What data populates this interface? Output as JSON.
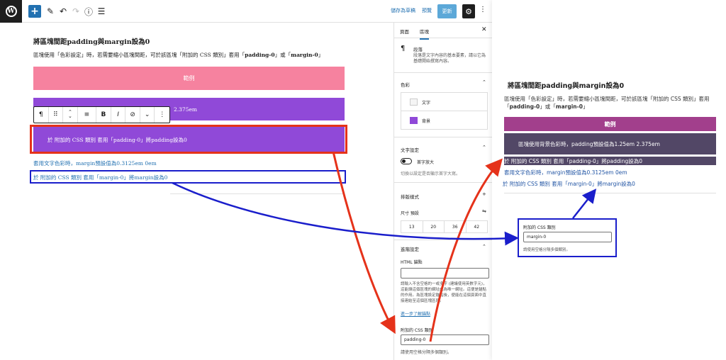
{
  "toolbar": {
    "logo_letter": "W",
    "add_icon": "plus-icon",
    "edit_icon": "pencil-icon",
    "undo_icon": "undo-icon",
    "redo_icon": "redo-icon",
    "info_icon": "info-icon",
    "list_view_icon": "list-view-icon",
    "save_draft_label": "儲存為草稿",
    "preview_label": "預覽",
    "update_label": "更新",
    "settings_icon": "gear-icon",
    "more_icon": "vertical-ellipsis-icon"
  },
  "editor": {
    "heading": "將區塊間距padding與margin設為0",
    "paragraph_parts": [
      "區塊使用「色彩設定」時，若需要縮小區塊間距，可於該區塊「附加的 CSS 類別」套用「",
      "padding-0",
      "」或「",
      "margin-0",
      "」"
    ],
    "pink_block_text": "範例",
    "purple_block1_text": "2.375em",
    "purple_block2_text": "於 附加的 CSS 類別 套用「padding-0」將padding設為0",
    "link1_text": "套用文字色彩時，margin預設值為0.3125em 0em",
    "link2_text": "於 附加的 CSS 類別 套用「margin-0」將margin設為0",
    "block_toolbar": {
      "paragraph_symbol": "¶",
      "drag_handle": "⠿",
      "move_arrows": "⌃⌄",
      "align_symbol": "≡",
      "bold": "B",
      "italic": "I",
      "link_symbol": "⊘",
      "chevron": "⌄",
      "more": "⋮"
    }
  },
  "sidebar": {
    "tabs": [
      "頁面",
      "區塊"
    ],
    "active_tab": "區塊",
    "close_symbol": "✕",
    "block_name": "段落",
    "block_desc": "段落是文字內容的基本要素，請以它為基礎開始撰寫內容。",
    "color_section": "色彩",
    "color_items": [
      {
        "label": "文字",
        "swatch": "#f5f5f5"
      },
      {
        "label": "背景",
        "swatch": "#9049d8"
      }
    ],
    "text_settings_section": "文字設定",
    "drop_cap_label": "首字放大",
    "drop_cap_help": "切換以設定是否顯示首字大寫。",
    "typography_section": "排版樣式",
    "size_label": "尺寸 預設",
    "font_sizes": [
      "13",
      "20",
      "36",
      "42"
    ],
    "advanced_section": "進階設定",
    "html_anchor_label": "HTML 錨點",
    "html_anchor_value": "",
    "html_anchor_help": "請輸入不含空格的一或多字 (建議使用英數字元)，這能讓這個區塊的網址成為唯一網址。這便是錨點的作用。為區塊設定錨點後，便能在這個頁面中直接連結至這個區塊區段。",
    "learn_more": "進一步了解錨點",
    "css_class_label": "附加的 CSS 類別",
    "css_class_value": "padding-0",
    "css_class_help": "請使用空格分隔多個類別。"
  },
  "preview": {
    "heading": "將區塊間距padding與margin設為0",
    "paragraph_parts": [
      "區塊使用「色彩設定」時，若需要縮小區塊間距，可於該區塊「附加的 CSS 類別」套用「",
      "padding-0",
      "」或「",
      "margin-0",
      "」"
    ],
    "magenta_block_text": "範例",
    "purple_block_text": "區塊使用背景色彩時，padding預設值為1.25em 2.375em",
    "dark_block_text": "於 附加的 CSS 類別 套用「padding-0」將padding設為0",
    "link1_text": "套用文字色彩時，margin預設值為0.3125em 0em",
    "link2_text": "於 附加的 CSS 類別 套用「margin-0」將margin設為0",
    "css_box": {
      "label": "附加的 CSS 類別",
      "value": "margin-0",
      "help": "請使用空格分隔多個類別。"
    }
  },
  "colors": {
    "accent_blue": "#2271b1",
    "pink": "#f6829f",
    "purple": "#9049d8",
    "magenta": "#a23f8c",
    "dark_purple": "#524766",
    "annotation_red": "#e5321a",
    "annotation_blue": "#1a1ecb"
  }
}
